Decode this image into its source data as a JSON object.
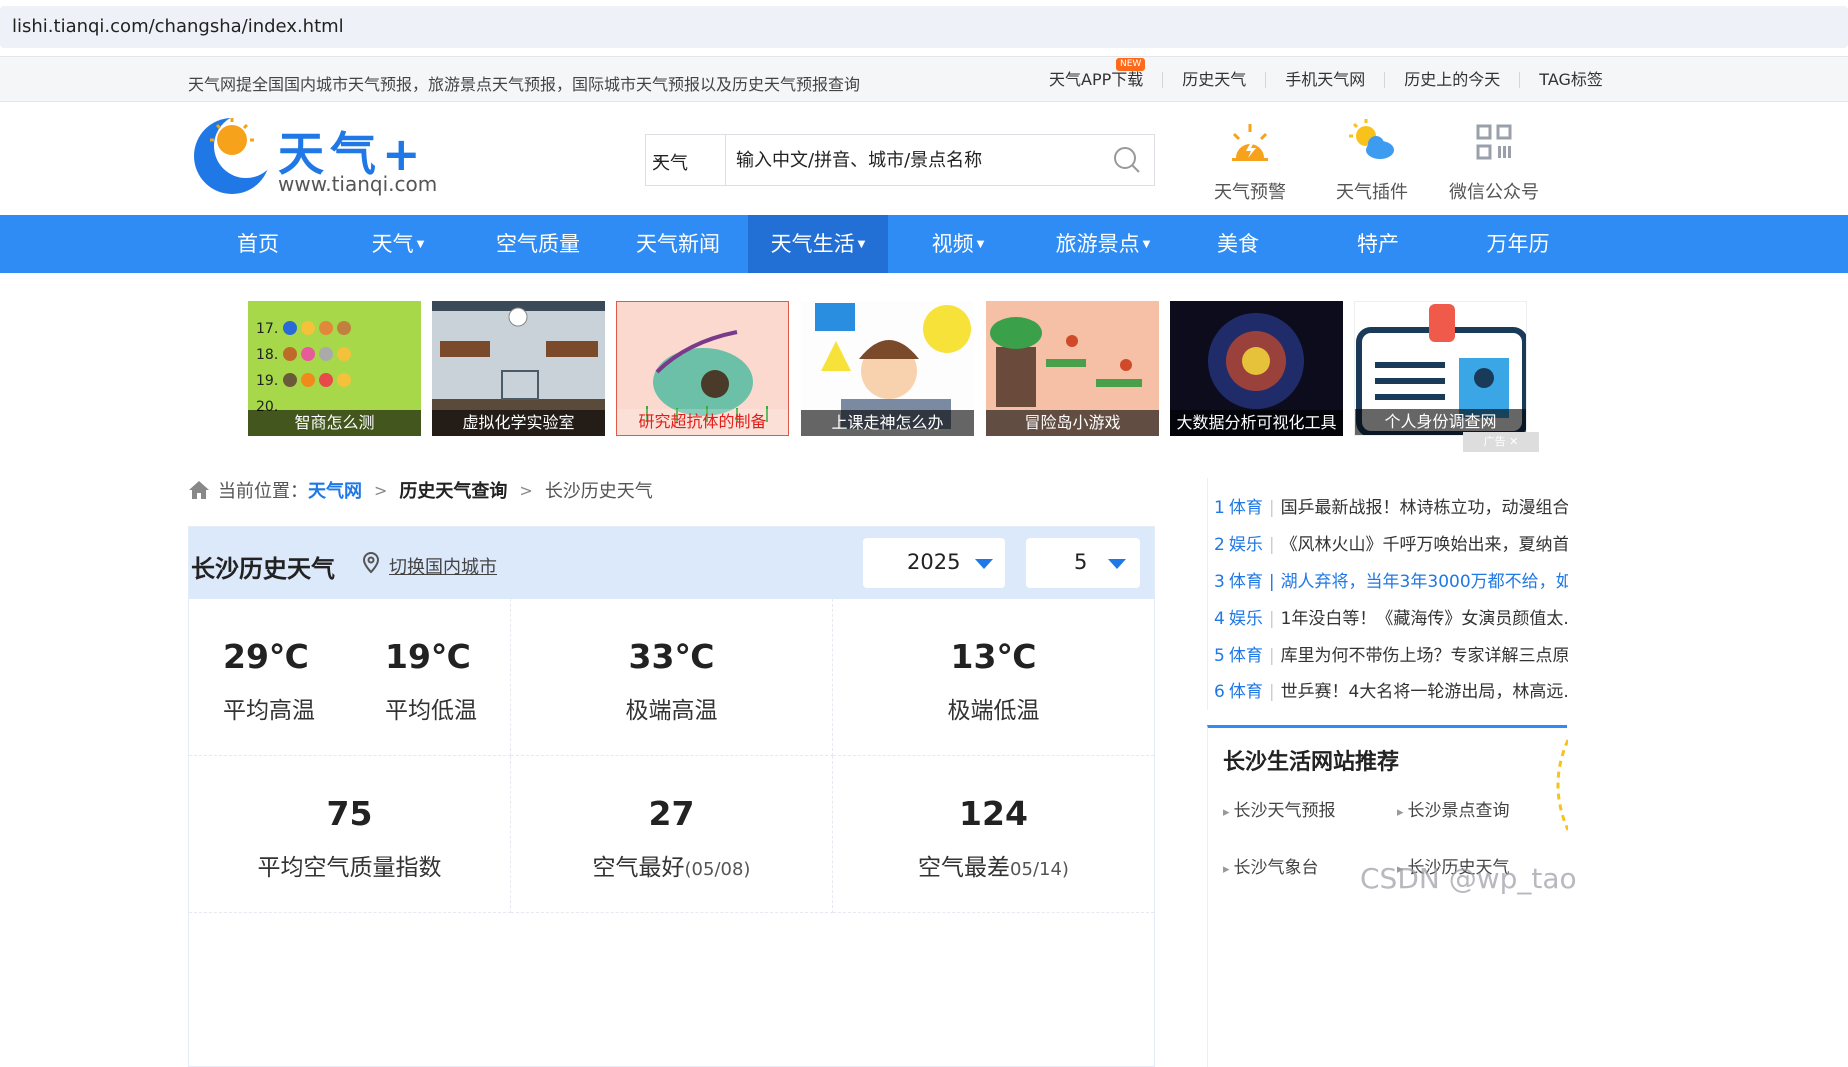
{
  "browser": {
    "url": "lishi.tianqi.com/changsha/index.html"
  },
  "topbar": {
    "intro": "天气网提全国国内城市天气预报，旅游景点天气预报，国际城市天气预报以及历史天气预报查询",
    "links": [
      "天气APP下载",
      "历史天气",
      "手机天气网",
      "历史上的今天",
      "TAG标签"
    ],
    "new_badge": "NEW"
  },
  "header": {
    "logo_text": "天气+",
    "logo_url": "www.tianqi.com",
    "search_select": "天气",
    "search_placeholder": "输入中文/拼音、城市/景点名称",
    "icons": [
      {
        "label": "天气预警",
        "icon": "warning-sun-icon"
      },
      {
        "label": "天气插件",
        "icon": "sun-cloud-icon"
      },
      {
        "label": "微信公众号",
        "icon": "qr-code-icon"
      }
    ]
  },
  "nav": {
    "items": [
      {
        "label": "首页",
        "dropdown": false
      },
      {
        "label": "天气",
        "dropdown": true
      },
      {
        "label": "空气质量",
        "dropdown": false
      },
      {
        "label": "天气新闻",
        "dropdown": false
      },
      {
        "label": "天气生活",
        "dropdown": true,
        "active": true
      },
      {
        "label": "视频",
        "dropdown": true
      },
      {
        "label": "旅游景点",
        "dropdown": true
      },
      {
        "label": "美食",
        "dropdown": false
      },
      {
        "label": "特产",
        "dropdown": false
      },
      {
        "label": "万年历",
        "dropdown": false
      }
    ]
  },
  "banners": {
    "items": [
      "智商怎么测",
      "虚拟化学实验室",
      "研究超抗体的制备",
      "上课走神怎么办",
      "冒险岛小游戏",
      "大数据分析可视化工具",
      "个人身份调查网"
    ],
    "ad_label": "广告"
  },
  "breadcrumb": {
    "prefix": "当前位置：",
    "items": [
      "天气网",
      "历史天气查询",
      "长沙历史天气"
    ]
  },
  "panel": {
    "title": "长沙历史天气",
    "switch_link": "切换国内城市",
    "year": "2025",
    "month": "5",
    "stats_row1": [
      {
        "value": "29℃",
        "label": "平均高温"
      },
      {
        "value": "19℃",
        "label": "平均低温"
      },
      {
        "value": "33℃",
        "label": "极端高温"
      },
      {
        "value": "13℃",
        "label": "极端低温"
      }
    ],
    "stats_row2": [
      {
        "value": "75",
        "label": "平均空气质量指数",
        "date": ""
      },
      {
        "value": "27",
        "label": "空气最好",
        "date": "(05/08)"
      },
      {
        "value": "124",
        "label": "空气最差",
        "date": "05/14)"
      }
    ]
  },
  "news": {
    "items": [
      {
        "num": "1",
        "cat": "体育",
        "text": "国乒最新战报！林诗栋立功，动漫组合..."
      },
      {
        "num": "2",
        "cat": "娱乐",
        "text": "《风林火山》千呼万唤始出来，夏纳首..."
      },
      {
        "num": "3",
        "cat": "体育",
        "text": "湖人弃将，当年3年3000万都不给，如..."
      },
      {
        "num": "4",
        "cat": "娱乐",
        "text": "1年没白等！《藏海传》女演员颜值太..."
      },
      {
        "num": "5",
        "cat": "体育",
        "text": "库里为何不带伤上场？专家详解三点原..."
      },
      {
        "num": "6",
        "cat": "体育",
        "text": "世乒赛！4大名将一轮游出局，林高远..."
      }
    ]
  },
  "recommend": {
    "title": "长沙生活网站推荐",
    "links": [
      "长沙天气预报",
      "长沙景点查询",
      "长沙气象台",
      "长沙历史天气"
    ]
  },
  "watermark": "CSDN @wp_tao",
  "colors": {
    "nav": "#2f8cf5",
    "nav_active": "#2270d6",
    "accent": "#1f78e6",
    "panel_header": "#dce9fb"
  }
}
